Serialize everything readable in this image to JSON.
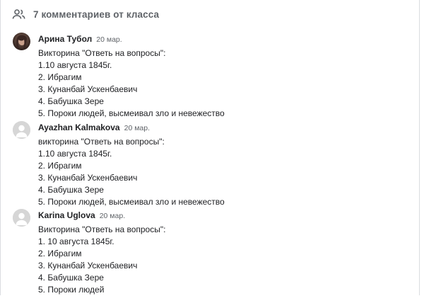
{
  "header": {
    "title": "7 комментариев от класса",
    "icon": "people-icon"
  },
  "comments": [
    {
      "author": "Арина Тубол",
      "date": "20 мар.",
      "avatar": "photo",
      "lines": [
        "Викторина \"Ответь на вопросы\":",
        "1.10 августа 1845г.",
        "2. Ибрагим",
        "3. Кунанбай Ускенбаевич",
        "4. Бабушка Зере",
        "5. Пороки людей, высмеивал зло и невежество"
      ]
    },
    {
      "author": "Ayazhan Kalmakova",
      "date": "20 мар.",
      "avatar": "default-avatar-icon",
      "lines": [
        "викторина \"Ответь на вопросы\":",
        "1.10 августа 1845г.",
        "2. Ибрагим",
        "3. Кунанбай Ускенбаевич",
        "4. Бабушка Зере",
        "5. Пороки людей, высмеивал зло и невежество"
      ]
    },
    {
      "author": "Karina Uglova",
      "date": "20 мар.",
      "avatar": "default-avatar-icon",
      "lines": [
        "Викторина \"Ответь на вопросы\":",
        "1. 10 августа 1845г.",
        "2. Ибрагим",
        "3. Кунанбай Ускенбаевич",
        "4. Бабушка Зере",
        "5. Пороки людей"
      ]
    }
  ]
}
